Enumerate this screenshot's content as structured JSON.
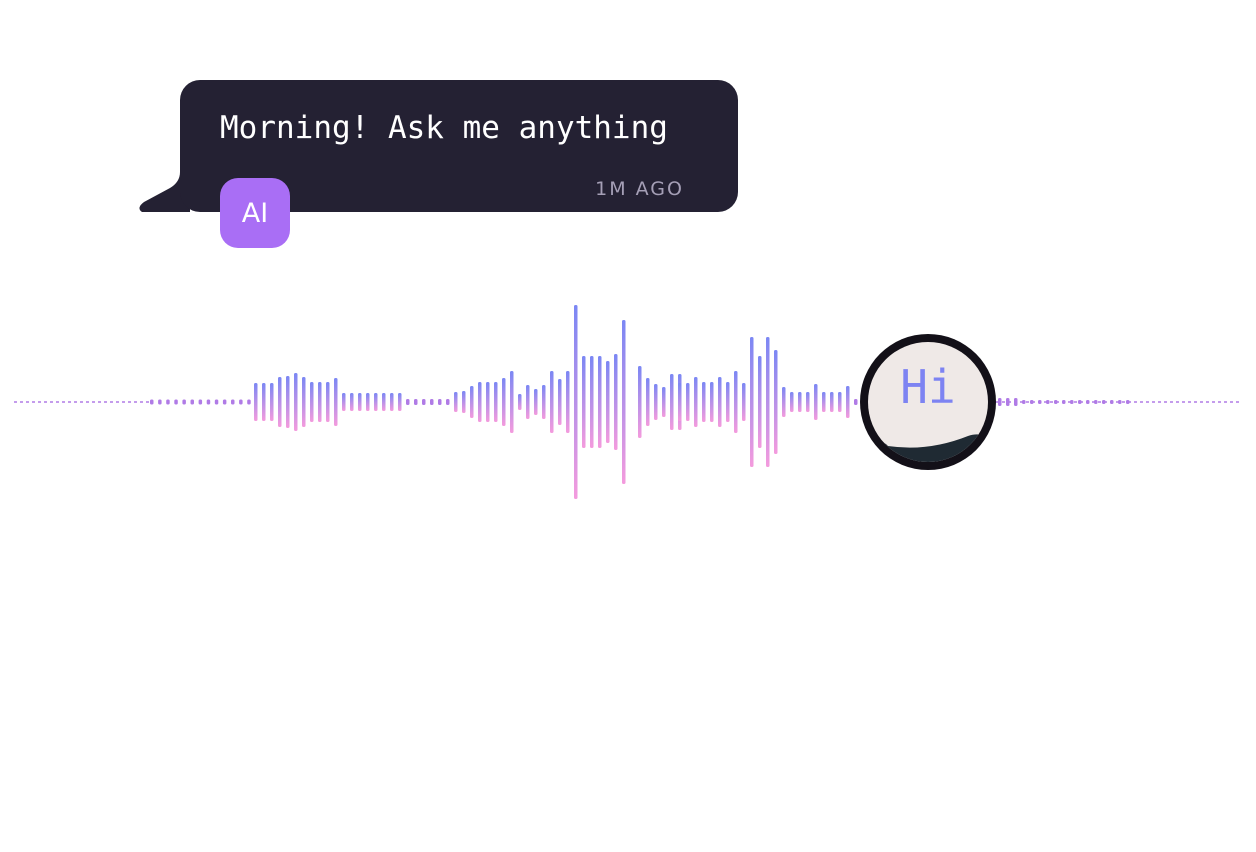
{
  "chat": {
    "message": "Morning! Ask me anything",
    "timestamp": "1M AGO",
    "sender_badge": "AI",
    "bubble_color": "#242133",
    "badge_color": "#a96ef5"
  },
  "voice": {
    "avatar_label": "Hi",
    "wave_colors": {
      "top": "#7b87f4",
      "bottom": "#f49bdd",
      "line": "#b07be6"
    }
  }
}
